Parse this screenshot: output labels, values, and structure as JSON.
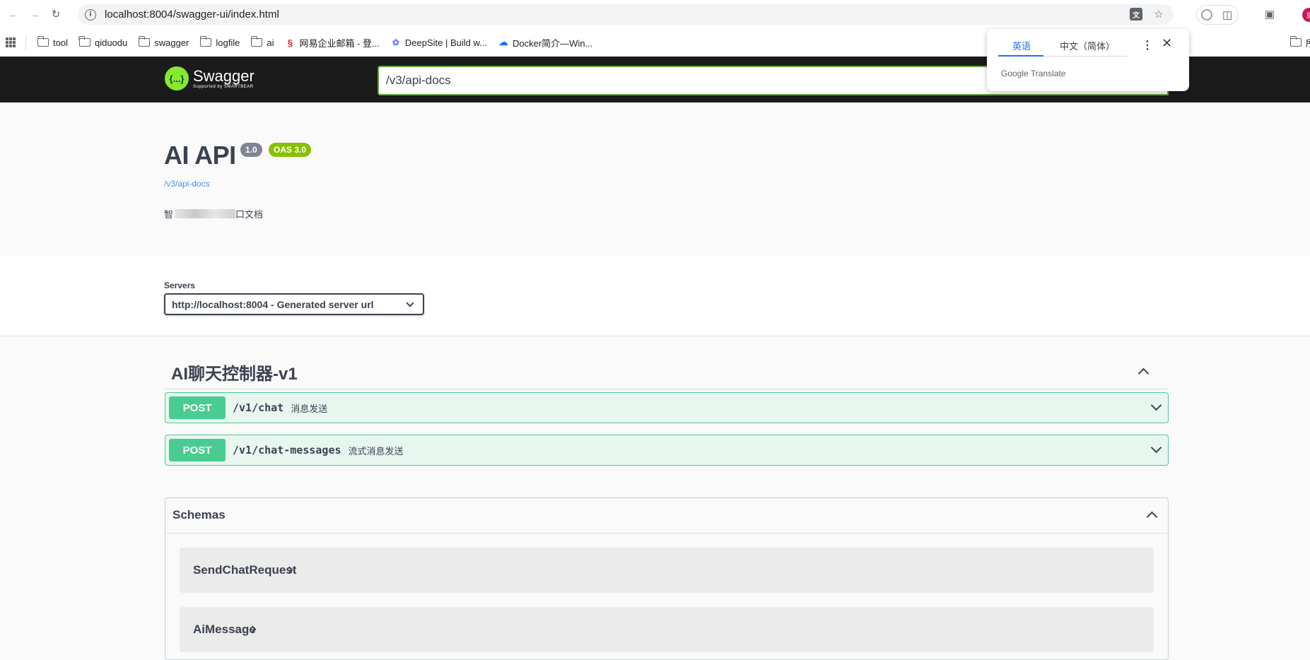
{
  "browser": {
    "url": "localhost:8004/swagger-ui/index.html",
    "avatar_text": "京"
  },
  "bookmarks": [
    {
      "label": "tool",
      "icon": "folder-icon"
    },
    {
      "label": "qiduodu",
      "icon": "folder-icon"
    },
    {
      "label": "swagger",
      "icon": "folder-icon"
    },
    {
      "label": "logfile",
      "icon": "folder-icon"
    },
    {
      "label": "ai",
      "icon": "folder-icon"
    },
    {
      "label": "网易企业邮箱 - 登...",
      "icon": "netease-icon"
    },
    {
      "label": "DeepSite | Build w...",
      "icon": "deepsite-icon"
    },
    {
      "label": "Docker简介—Win...",
      "icon": "cloud-icon"
    }
  ],
  "bookmarks_overflow": "所",
  "translate": {
    "tab_source": "英语",
    "tab_target": "中文（简体）",
    "brand_google": "Google",
    "brand_translate": "Translate"
  },
  "swagger": {
    "logo_name": "Swagger",
    "logo_sub": "Supported by SMARTBEAR",
    "logo_mark": "{...}",
    "explore_value": "/v3/api-docs"
  },
  "info": {
    "title": "AI API",
    "version": "1.0",
    "oas": "OAS 3.0",
    "spec_link": "/v3/api-docs",
    "description_start": "智",
    "description_end": "口文档"
  },
  "servers": {
    "label": "Servers",
    "selected": "http://localhost:8004 - Generated server url"
  },
  "tag": {
    "name": "AI聊天控制器-v1"
  },
  "operations": [
    {
      "method": "POST",
      "path": "/v1/chat",
      "summary": "消息发送"
    },
    {
      "method": "POST",
      "path": "/v1/chat-messages",
      "summary": "流式消息发送"
    }
  ],
  "schemas": {
    "title": "Schemas",
    "models": [
      "SendChatRequest",
      "AiMessage"
    ]
  },
  "colors": {
    "post": "#49cc90",
    "post_bg": "#e8f6f0",
    "swagger_green": "#85ea2d",
    "topbar_bg": "#1b1b1b",
    "link": "#4990e2"
  }
}
